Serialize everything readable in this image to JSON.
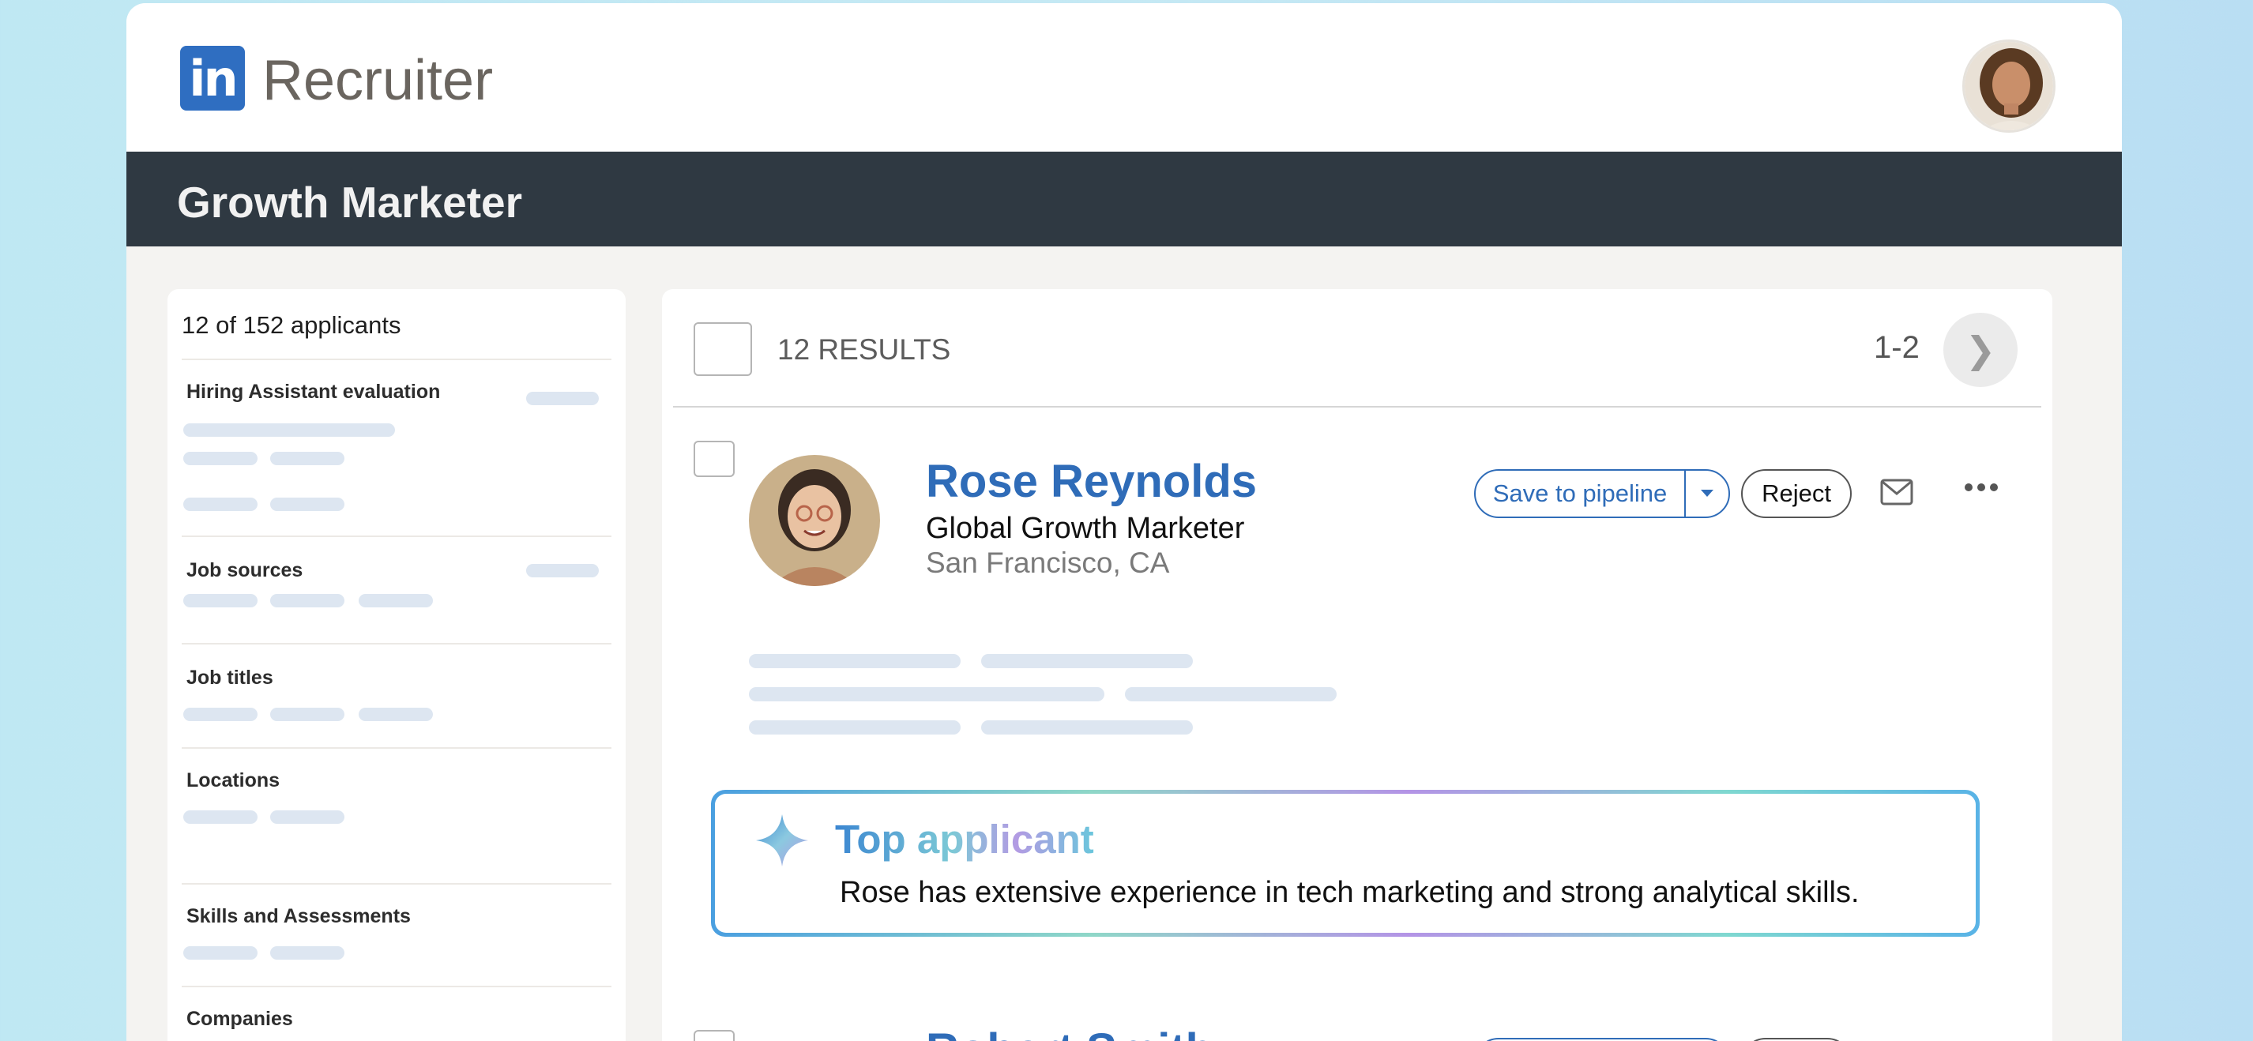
{
  "app": {
    "logo_text": "in",
    "title": "Recruiter"
  },
  "job": {
    "title": "Growth Marketer"
  },
  "sidebar": {
    "count_label": "12 of 152 applicants",
    "sections": [
      {
        "label": "Hiring Assistant evaluation"
      },
      {
        "label": "Job sources"
      },
      {
        "label": "Job titles"
      },
      {
        "label": "Locations"
      },
      {
        "label": "Skills and Assessments"
      },
      {
        "label": "Companies"
      }
    ]
  },
  "results": {
    "label": "12 RESULTS",
    "page_range": "1-2",
    "next_glyph": "❯"
  },
  "candidate": {
    "name": "Rose Reynolds",
    "title": "Global Growth Marketer",
    "location": "San Francisco, CA",
    "save_label": "Save to pipeline",
    "reject_label": "Reject"
  },
  "top_applicant": {
    "heading": "Top applicant",
    "text": "Rose has extensive experience in tech marketing and strong analytical skills."
  },
  "candidate2": {
    "name": "Robert Smith"
  },
  "colors": {
    "brand_blue": "#2f6ec1",
    "job_bar": "#2f3942",
    "name_blue": "#2f6cb8"
  }
}
